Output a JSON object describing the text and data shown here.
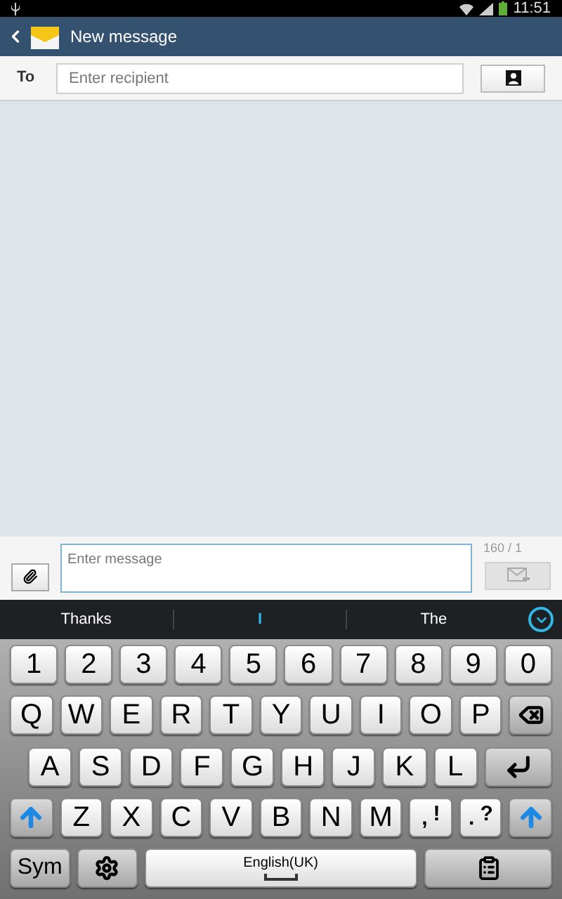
{
  "status_bar": {
    "time": "11:51"
  },
  "app_bar": {
    "title": "New message"
  },
  "recipient": {
    "label": "To",
    "placeholder": "Enter recipient"
  },
  "compose": {
    "placeholder": "Enter message",
    "counter": "160 / 1"
  },
  "suggestions": [
    {
      "text": "Thanks",
      "selected": false
    },
    {
      "text": "I",
      "selected": true
    },
    {
      "text": "The",
      "selected": false
    }
  ],
  "keyboard": {
    "key_rows": [
      {
        "keys": [
          {
            "kind": "char",
            "label": "1"
          },
          {
            "kind": "char",
            "label": "2"
          },
          {
            "kind": "char",
            "label": "3"
          },
          {
            "kind": "char",
            "label": "4"
          },
          {
            "kind": "char",
            "label": "5"
          },
          {
            "kind": "char",
            "label": "6"
          },
          {
            "kind": "char",
            "label": "7"
          },
          {
            "kind": "char",
            "label": "8"
          },
          {
            "kind": "char",
            "label": "9"
          },
          {
            "kind": "char",
            "label": "0"
          }
        ]
      },
      {
        "keys": [
          {
            "kind": "char",
            "label": "Q"
          },
          {
            "kind": "char",
            "label": "W"
          },
          {
            "kind": "char",
            "label": "E"
          },
          {
            "kind": "char",
            "label": "R"
          },
          {
            "kind": "char",
            "label": "T"
          },
          {
            "kind": "char",
            "label": "Y"
          },
          {
            "kind": "char",
            "label": "U"
          },
          {
            "kind": "char",
            "label": "I"
          },
          {
            "kind": "char",
            "label": "O"
          },
          {
            "kind": "char",
            "label": "P"
          },
          {
            "kind": "backspace"
          }
        ]
      },
      {
        "keys": [
          {
            "kind": "char",
            "label": "A"
          },
          {
            "kind": "char",
            "label": "S"
          },
          {
            "kind": "char",
            "label": "D"
          },
          {
            "kind": "char",
            "label": "F"
          },
          {
            "kind": "char",
            "label": "G"
          },
          {
            "kind": "char",
            "label": "H"
          },
          {
            "kind": "char",
            "label": "J"
          },
          {
            "kind": "char",
            "label": "K"
          },
          {
            "kind": "char",
            "label": "L"
          },
          {
            "kind": "enter"
          }
        ]
      },
      {
        "keys": [
          {
            "kind": "shift"
          },
          {
            "kind": "char",
            "label": "Z"
          },
          {
            "kind": "char",
            "label": "X"
          },
          {
            "kind": "char",
            "label": "C"
          },
          {
            "kind": "char",
            "label": "V"
          },
          {
            "kind": "char",
            "label": "B"
          },
          {
            "kind": "char",
            "label": "N"
          },
          {
            "kind": "char",
            "label": "M"
          },
          {
            "kind": "punct",
            "label": ",",
            "alt": "!"
          },
          {
            "kind": "punct",
            "label": ".",
            "alt": "?"
          },
          {
            "kind": "shift"
          }
        ]
      },
      {
        "keys": [
          {
            "kind": "sym",
            "label": "Sym"
          },
          {
            "kind": "settings"
          },
          {
            "kind": "space",
            "label": "English(UK)"
          },
          {
            "kind": "clipboard"
          }
        ]
      }
    ]
  }
}
